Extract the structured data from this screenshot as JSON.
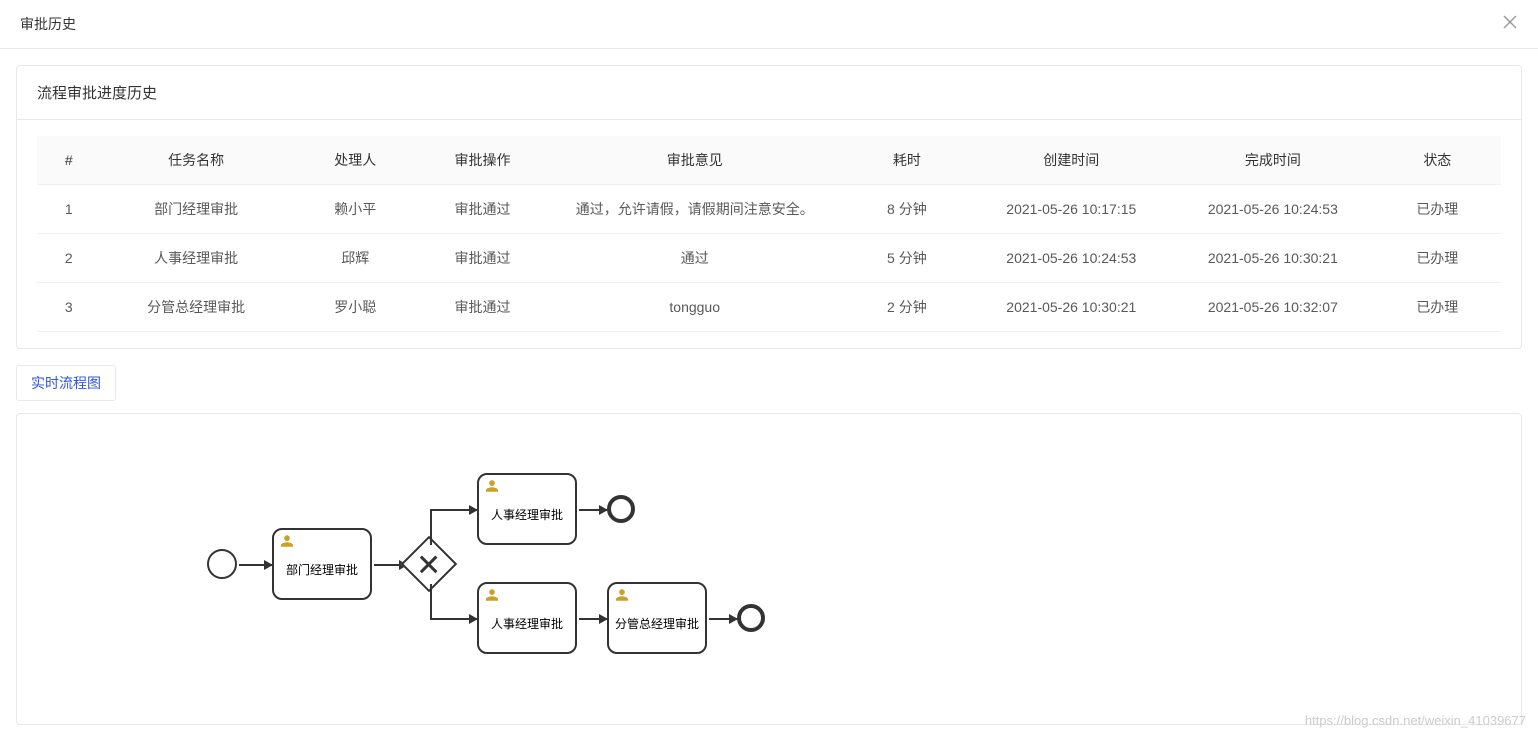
{
  "modal": {
    "title": "审批历史"
  },
  "card": {
    "title": "流程审批进度历史"
  },
  "table": {
    "headers": {
      "idx": "#",
      "task": "任务名称",
      "handler": "处理人",
      "op": "审批操作",
      "comment": "审批意见",
      "duration": "耗时",
      "created": "创建时间",
      "finished": "完成时间",
      "status": "状态"
    },
    "rows": [
      {
        "idx": "1",
        "task": "部门经理审批",
        "handler": "赖小平",
        "op": "审批通过",
        "comment": "通过，允许请假，请假期间注意安全。",
        "duration": "8 分钟",
        "created": "2021-05-26 10:17:15",
        "finished": "2021-05-26 10:24:53",
        "status": "已办理"
      },
      {
        "idx": "2",
        "task": "人事经理审批",
        "handler": "邱辉",
        "op": "审批通过",
        "comment": "通过",
        "duration": "5 分钟",
        "created": "2021-05-26 10:24:53",
        "finished": "2021-05-26 10:30:21",
        "status": "已办理"
      },
      {
        "idx": "3",
        "task": "分管总经理审批",
        "handler": "罗小聪",
        "op": "审批通过",
        "comment": "tongguo",
        "duration": "2 分钟",
        "created": "2021-05-26 10:30:21",
        "finished": "2021-05-26 10:32:07",
        "status": "已办理"
      }
    ]
  },
  "tabs": {
    "realtime": "实时流程图"
  },
  "diagram": {
    "task1": "部门经理审批",
    "task2a": "人事经理审批",
    "task2b": "人事经理审批",
    "task3": "分管总经理审批"
  },
  "watermark": "https://blog.csdn.net/weixin_41039677"
}
